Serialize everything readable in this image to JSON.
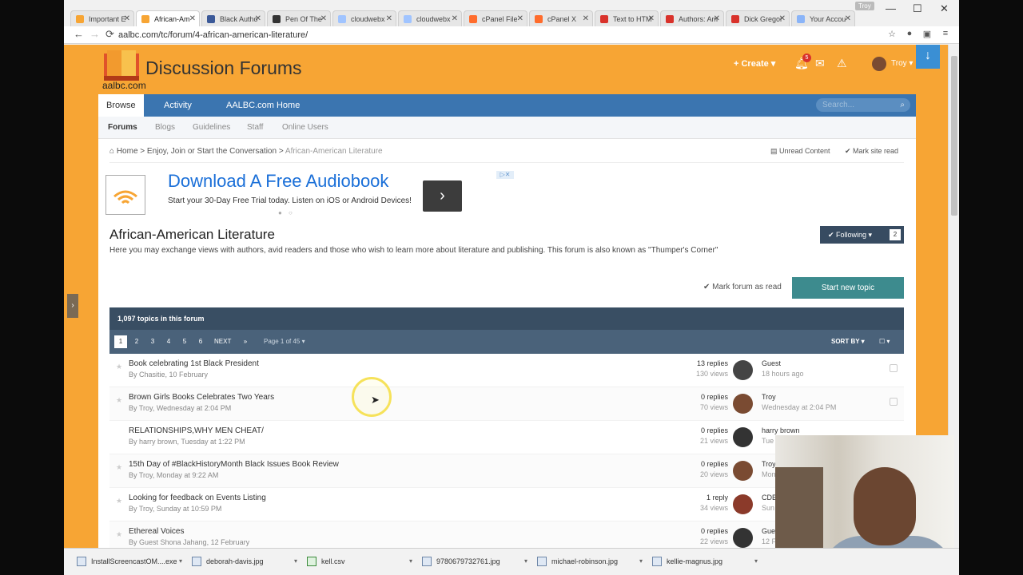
{
  "browser": {
    "tabs": [
      {
        "label": "Important E",
        "color": "#f7a534"
      },
      {
        "label": "African-Am",
        "color": "#f7a534"
      },
      {
        "label": "Black Autho",
        "color": "#3b5998"
      },
      {
        "label": "Pen Of The",
        "color": "#333333"
      },
      {
        "label": "cloudwebx",
        "color": "#a0c4ff"
      },
      {
        "label": "cloudwebx",
        "color": "#a0c4ff"
      },
      {
        "label": "cPanel File",
        "color": "#ff6c2c"
      },
      {
        "label": "cPanel X",
        "color": "#ff6c2c"
      },
      {
        "label": "Text to HTM",
        "color": "#d9322b"
      },
      {
        "label": "Authors: Am",
        "color": "#d9322b"
      },
      {
        "label": "Dick Gregor",
        "color": "#d9322b"
      },
      {
        "label": "Your Accou",
        "color": "#8ab4f8"
      }
    ],
    "user_badge": "Troy",
    "url": "aalbc.com/tc/forum/4-african-american-literature/"
  },
  "header": {
    "site_title": "Discussion Forums",
    "site_sub": "aalbc.com",
    "create_label": "+ Create ▾",
    "notifications_count": "5",
    "user_name": "Troy ▾"
  },
  "nav": {
    "tabs": [
      "Browse",
      "Activity",
      "AALBC.com Home"
    ],
    "search_placeholder": "Search...",
    "sub": [
      "Forums",
      "Blogs",
      "Guidelines",
      "Staff",
      "Online Users"
    ]
  },
  "breadcrumb": {
    "home": "Home",
    "sep1": ">",
    "cat": "Enjoy, Join or Start the Conversation",
    "sep2": ">",
    "current": "African-American Literature",
    "unread": "Unread Content",
    "mark_site": "Mark site read"
  },
  "ad": {
    "title": "Download A Free Audiobook",
    "text": "Start your 30-Day Free Trial today. Listen on iOS or Android Devices!"
  },
  "forum": {
    "title": "African-American Literature",
    "description": "Here you may exchange views with authors, avid readers and those who wish to learn more about literature and publishing. This forum is also known as \"Thumper's Corner\"",
    "following_label": "✔ Following ▾",
    "following_count": "2",
    "mark_read": "✔ Mark forum as read",
    "start_topic": "Start new topic",
    "topics_count": "1,097 topics in this forum"
  },
  "pager": {
    "pages": [
      "1",
      "2",
      "3",
      "4",
      "5",
      "6",
      "NEXT",
      "»"
    ],
    "info": "Page 1 of 45 ▾",
    "sort": "SORT BY ▾",
    "select": "☐ ▾"
  },
  "topics": [
    {
      "title": "Book celebrating 1st Black President",
      "by": "By Chasitie, 10 February",
      "replies": "13 replies",
      "views": "130 views",
      "last_user": "Guest",
      "last_time": "18 hours ago"
    },
    {
      "title": "Brown Girls Books Celebrates Two Years",
      "by": "By Troy, Wednesday at 2:04 PM",
      "replies": "0 replies",
      "views": "70 views",
      "last_user": "Troy",
      "last_time": "Wednesday at 2:04 PM"
    },
    {
      "title": "RELATIONSHIPS,WHY MEN CHEAT/",
      "by": "By harry brown, Tuesday at 1:22 PM",
      "replies": "0 replies",
      "views": "21 views",
      "last_user": "harry brown",
      "last_time": "Tue"
    },
    {
      "title": "15th Day of #BlackHistoryMonth Black Issues Book Review",
      "by": "By Troy, Monday at 9:22 AM",
      "replies": "0 replies",
      "views": "20 views",
      "last_user": "Troy",
      "last_time": "Mon"
    },
    {
      "title": "Looking for feedback on Events Listing",
      "by": "By Troy, Sunday at 10:59 PM",
      "replies": "1 reply",
      "views": "34 views",
      "last_user": "CDB",
      "last_time": "Sun"
    },
    {
      "title": "Ethereal Voices",
      "by": "By Guest Shona Jahang, 12 February",
      "replies": "0 replies",
      "views": "22 views",
      "last_user": "Gues",
      "last_time": "12 F"
    }
  ],
  "downloads": [
    "InstallScreencastOM....exe",
    "deborah-davis.jpg",
    "kell.csv",
    "9780679732761.jpg",
    "michael-robinson.jpg",
    "kellie-magnus.jpg"
  ]
}
